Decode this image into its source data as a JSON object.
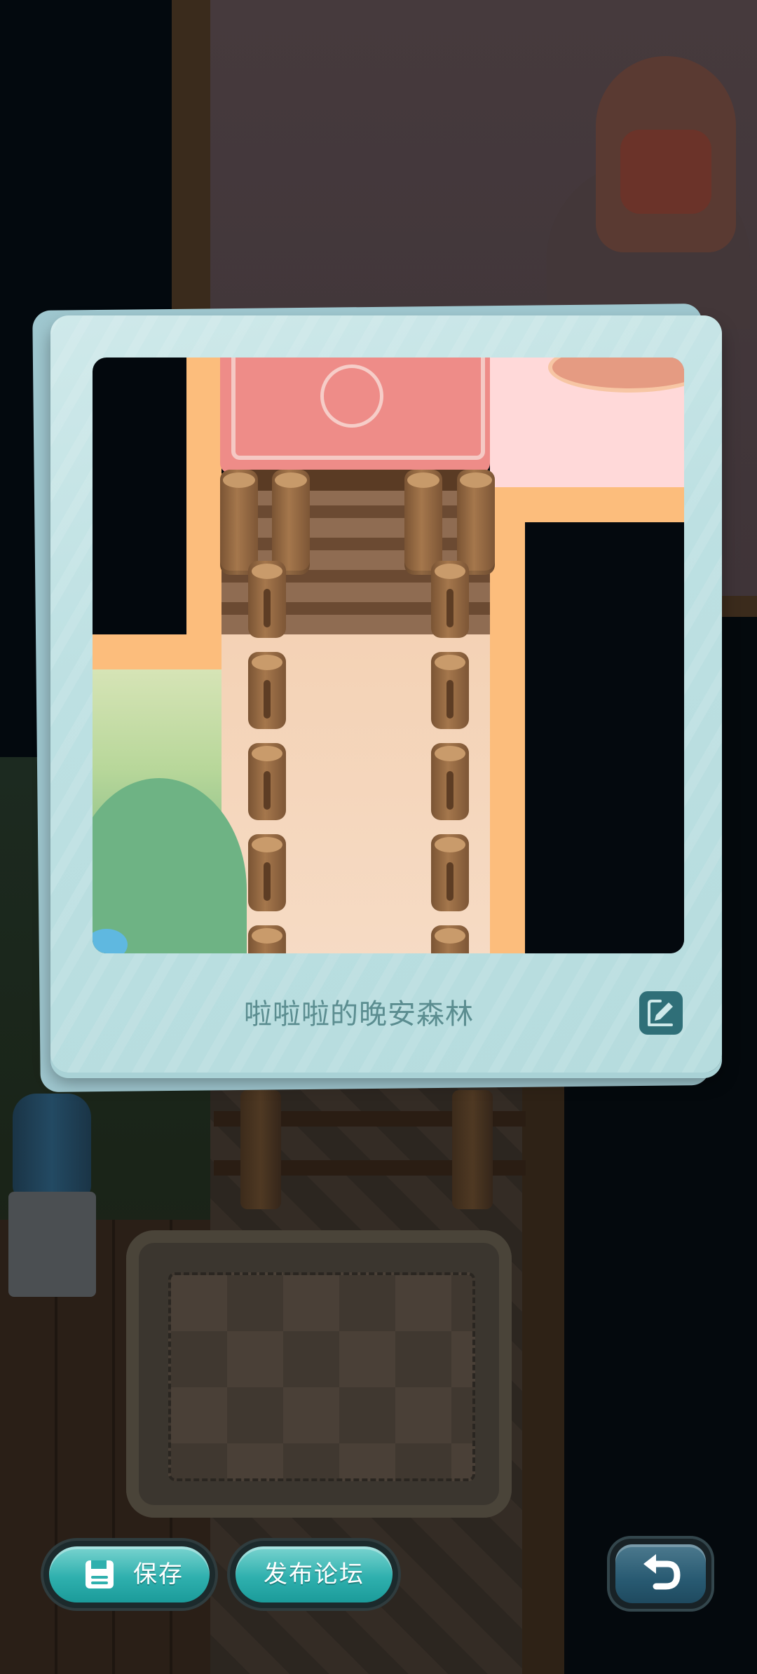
{
  "card": {
    "caption": "啦啦啦的晚安森林"
  },
  "icons": {
    "edit": "edit-pen-icon",
    "save": "floppy-disk-icon",
    "back": "undo-arrow-icon"
  },
  "buttons": {
    "save_label": "保存",
    "publish_label": "发布论坛"
  },
  "colors": {
    "card_bg": "#bde0e2",
    "button_teal": "#2fb0ae",
    "button_back": "#285a72",
    "caption_text": "#5b8d90"
  }
}
